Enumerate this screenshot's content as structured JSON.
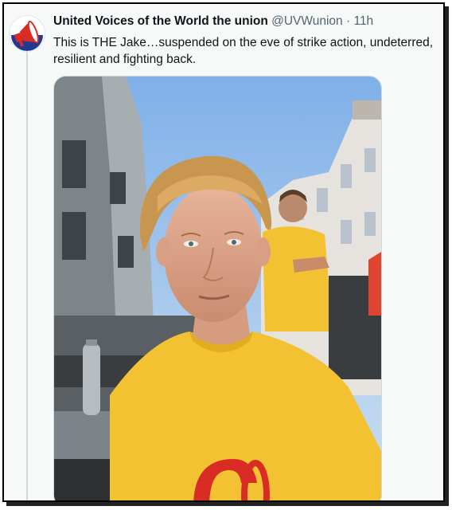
{
  "tweet": {
    "display_name": "United Voices of the World the union",
    "handle": "@UVWunion",
    "separator": "·",
    "time": "11h",
    "text": "This is THE Jake…suspended on the eve of strike action, undeterred, resilient and fighting back."
  },
  "icons": {
    "avatar": "megaphone-icon"
  },
  "colors": {
    "name": "#0f1419",
    "handle": "#536471",
    "shirt": "#f2c232",
    "logo": "#d82c24",
    "sky": "#8fb8e6"
  }
}
